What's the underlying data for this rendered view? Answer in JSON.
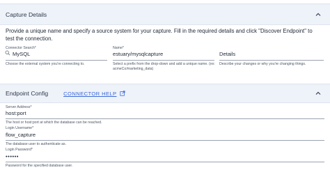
{
  "capture_details": {
    "title": "Capture Details",
    "description": "Provide a unique name and specify a source system for your capture. Fill in the required details and click \"Discover Endpoint\" to test the connection.",
    "connector_search": {
      "label": "Connector Search*",
      "value": "MySQL",
      "helper": "Choose the external system you're connecting to."
    },
    "name": {
      "label": "Name*",
      "value": "estuary/mysqlcapture",
      "helper": "Select a prefix from the drop-down and add a unique name. (ex: acmeCo/marketing_data)"
    },
    "details": {
      "value": "Details",
      "helper": "Describe your changes or why you're changing things."
    }
  },
  "endpoint_config": {
    "title": "Endpoint Config",
    "connector_help": "CONNECTOR HELP",
    "server_address": {
      "label": "Server Address*",
      "value": "host:port",
      "helper": "The host or host:port at which the database can be reached."
    },
    "login_username": {
      "label": "Login Username*",
      "value": "flow_capture",
      "helper": "The database user to authenticate as."
    },
    "login_password": {
      "label": "Login Password*",
      "value": "••••••",
      "helper": "Password for the specified database user."
    }
  },
  "icons": {
    "collapse": "chevron-up-icon",
    "search": "search-icon",
    "external": "external-link-icon"
  },
  "colors": {
    "header_bg": "#eef2f9",
    "link": "#3c6ad8"
  }
}
